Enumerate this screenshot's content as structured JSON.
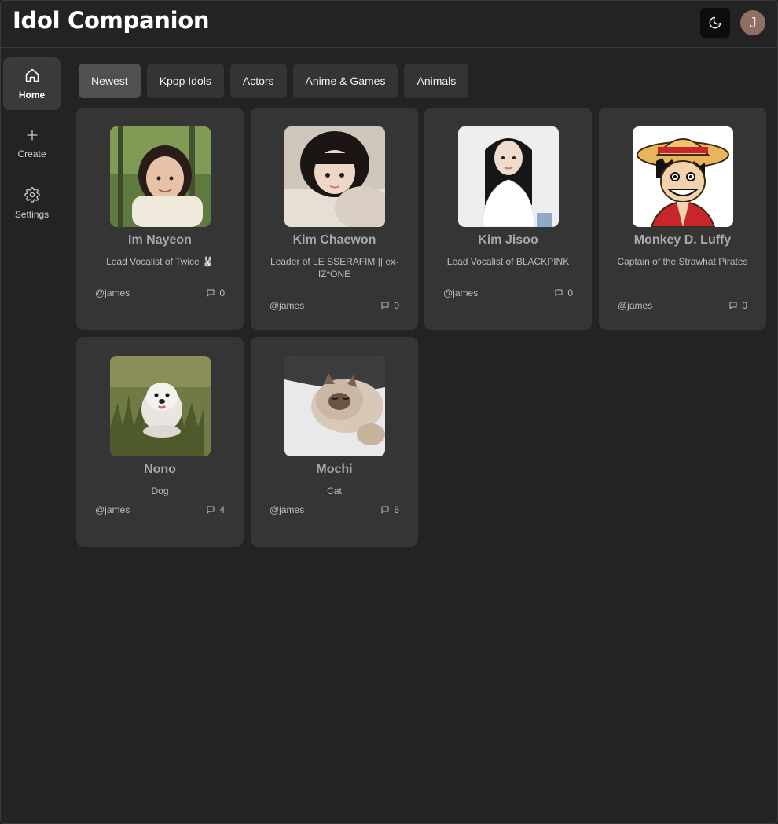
{
  "header": {
    "title": "Idol Companion",
    "theme_icon": "moon-icon",
    "avatar_initial": "J"
  },
  "sidebar": {
    "items": [
      {
        "label": "Home",
        "icon": "home-icon",
        "active": true
      },
      {
        "label": "Create",
        "icon": "plus-icon",
        "active": false
      },
      {
        "label": "Settings",
        "icon": "gear-icon",
        "active": false
      }
    ]
  },
  "tabs": [
    {
      "label": "Newest",
      "active": true
    },
    {
      "label": "Kpop Idols",
      "active": false
    },
    {
      "label": "Actors",
      "active": false
    },
    {
      "label": "Anime & Games",
      "active": false
    },
    {
      "label": "Animals",
      "active": false
    }
  ],
  "cards": [
    {
      "name": "Im Nayeon",
      "description": "Lead Vocalist of Twice 🐰",
      "author": "@james",
      "comments": "0"
    },
    {
      "name": "Kim Chaewon",
      "description": "Leader of LE SSERAFIM || ex-IZ*ONE",
      "author": "@james",
      "comments": "0"
    },
    {
      "name": "Kim Jisoo",
      "description": "Lead Vocalist of BLACKPINK",
      "author": "@james",
      "comments": "0"
    },
    {
      "name": "Monkey D. Luffy",
      "description": "Captain of the Strawhat Pirates",
      "author": "@james",
      "comments": "0"
    },
    {
      "name": "Nono",
      "description": "Dog",
      "author": "@james",
      "comments": "4"
    },
    {
      "name": "Mochi",
      "description": "Cat",
      "author": "@james",
      "comments": "6"
    }
  ],
  "colors": {
    "background": "#232323",
    "card": "#353535",
    "tab": "#343434",
    "tab_active": "#505050",
    "avatar": "#8e6f64"
  }
}
